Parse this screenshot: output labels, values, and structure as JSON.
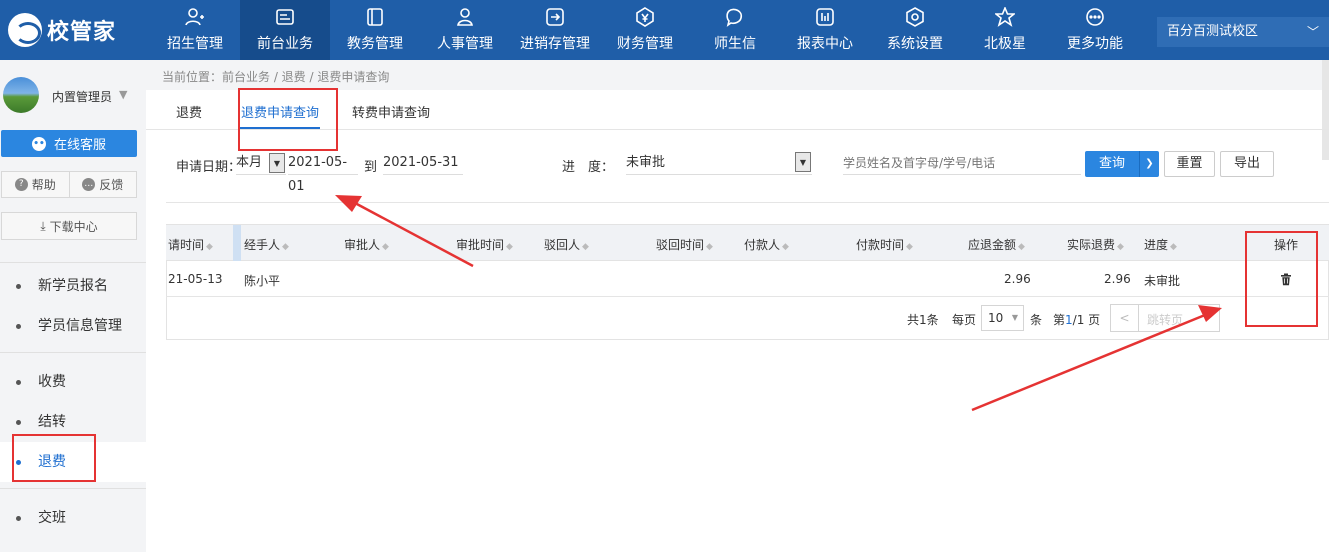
{
  "brand": {
    "name": "校管家"
  },
  "nav": {
    "items": [
      {
        "label": "招生管理",
        "icon": "user-plus-icon"
      },
      {
        "label": "前台业务",
        "icon": "reception-icon"
      },
      {
        "label": "教务管理",
        "icon": "book-icon"
      },
      {
        "label": "人事管理",
        "icon": "person-icon"
      },
      {
        "label": "进销存管理",
        "icon": "inventory-icon"
      },
      {
        "label": "财务管理",
        "icon": "finance-icon"
      },
      {
        "label": "师生信",
        "icon": "chat-icon"
      },
      {
        "label": "报表中心",
        "icon": "report-icon"
      },
      {
        "label": "系统设置",
        "icon": "settings-icon"
      },
      {
        "label": "北极星",
        "icon": "star-icon"
      },
      {
        "label": "更多功能",
        "icon": "more-icon"
      }
    ],
    "active_index": 1,
    "campus": "百分百测试校区"
  },
  "sidebar": {
    "user_name": "内置管理员",
    "online_service": "在线客服",
    "help": "帮助",
    "feedback": "反馈",
    "download": "下载中心",
    "items": [
      {
        "label": "新学员报名"
      },
      {
        "label": "学员信息管理"
      },
      {
        "label": "收费"
      },
      {
        "label": "结转"
      },
      {
        "label": "退费",
        "active": true
      },
      {
        "label": "交班"
      }
    ]
  },
  "breadcrumb": "当前位置：前台业务 / 退费 / 退费申请查询",
  "tabs": [
    {
      "label": "退费"
    },
    {
      "label": "退费申请查询",
      "active": true
    },
    {
      "label": "转费申请查询"
    }
  ],
  "filters": {
    "date_label": "申请日期：",
    "date_range_option": "本月",
    "date_from": "2021-05-01",
    "date_to_label": "到",
    "date_to": "2021-05-31",
    "progress_label": "进　度：",
    "progress_value": "未审批",
    "search_placeholder": "学员姓名及首字母/学号/电话",
    "query_button": "查询",
    "reset_button": "重置",
    "export_button": "导出"
  },
  "table": {
    "columns": [
      "请时间",
      "经手人",
      "审批人",
      "审批时间",
      "驳回人",
      "驳回时间",
      "付款人",
      "付款时间",
      "应退金额",
      "实际退费",
      "进度",
      "操作"
    ],
    "rows": [
      {
        "apply_time": "21-05-13",
        "handler": "陈小平",
        "approver": "",
        "approve_time": "",
        "rejecter": "",
        "reject_time": "",
        "payer": "",
        "pay_time": "",
        "refund_due": "2.96",
        "refund_actual": "2.96",
        "progress": "未审批"
      }
    ]
  },
  "pagination": {
    "total_text": "共1条",
    "per_page_label": "每页",
    "per_page": "10",
    "per_page_unit": "条",
    "page_prefix": "第",
    "page_current": "1",
    "page_suffix": "/1 页",
    "prev": "<",
    "jump": "跳转页"
  },
  "colors": {
    "nav_bg": "#1f5ea8",
    "accent": "#1f6fd0",
    "annotation": "#e53333"
  }
}
